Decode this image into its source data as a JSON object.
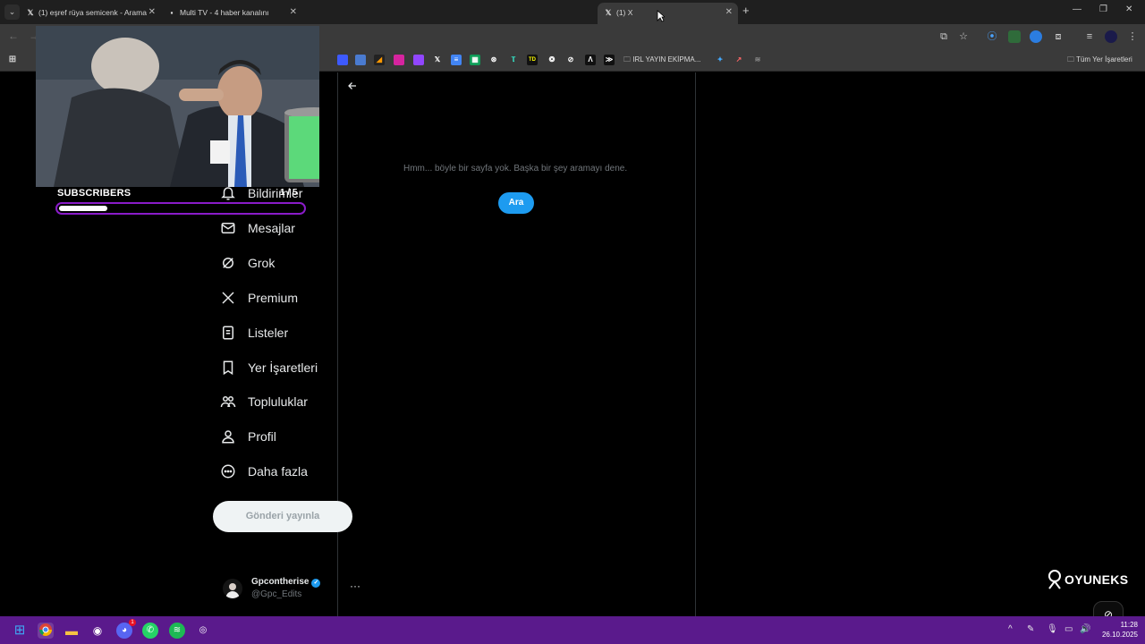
{
  "browser": {
    "tabs": [
      {
        "favicon": "x-icon",
        "title": "(1) eşref rüya semicenk - Arama",
        "active": false
      },
      {
        "favicon": "multitv-icon",
        "title": "Multi TV - 4 haber kanalını",
        "active": false
      },
      {
        "favicon": "x-icon",
        "title": "(1) X",
        "active": true
      }
    ],
    "new_tab_label": "+",
    "bookmarks_folder": "IRL YAYIN EKİPMA...",
    "all_bookmarks": "Tüm Yer İşaretleri"
  },
  "sidebar": {
    "items": [
      {
        "icon": "bell-icon",
        "label": "Bildirimler"
      },
      {
        "icon": "envelope-icon",
        "label": "Mesajlar"
      },
      {
        "icon": "grok-icon",
        "label": "Grok"
      },
      {
        "icon": "x-logo-icon",
        "label": "Premium"
      },
      {
        "icon": "list-icon",
        "label": "Listeler"
      },
      {
        "icon": "bookmark-icon",
        "label": "Yer İşaretleri"
      },
      {
        "icon": "communities-icon",
        "label": "Topluluklar"
      },
      {
        "icon": "person-icon",
        "label": "Profil"
      },
      {
        "icon": "more-circle-icon",
        "label": "Daha fazla"
      }
    ],
    "post_button": "Gönderi yayınla",
    "account": {
      "name": "Gpcontherise",
      "handle": "@Gpc_Edits",
      "more": "···"
    }
  },
  "main": {
    "empty_message": "Hmm... böyle bir sayfa yok. Başka bir şey aramayı dene.",
    "search_button": "Ara"
  },
  "overlay": {
    "subscribers_label": "SUBSCRIBERS",
    "subscribers_count": "1 / 5",
    "progress": 0.2,
    "brand": "OYUNEKS"
  },
  "taskbar": {
    "time": "11:28",
    "date": "26.10.2025",
    "discord_badge": "1"
  },
  "colors": {
    "accent": "#1d9bf0",
    "taskbar": "#5a1a8c",
    "subs_border": "#8a1bc9"
  }
}
